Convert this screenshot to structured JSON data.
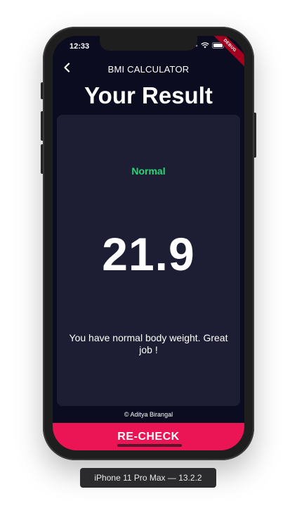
{
  "status_bar": {
    "time": "12:33"
  },
  "debug_banner": "DEBUG",
  "app_bar": {
    "title": "BMI CALCULATOR",
    "back_icon": "chevron-left-icon"
  },
  "heading": "Your Result",
  "result": {
    "status": "Normal",
    "bmi_value": "21.9",
    "message": "You have normal body weight. Great job !"
  },
  "credit": "© Aditya Birangal",
  "recheck_button": {
    "label": "RE-CHECK"
  },
  "device_label": "iPhone 11 Pro Max — 13.2.2",
  "colors": {
    "background": "#0b0c1f",
    "card": "#1d1e33",
    "accent": "#eb1555",
    "status_normal": "#24d876"
  }
}
